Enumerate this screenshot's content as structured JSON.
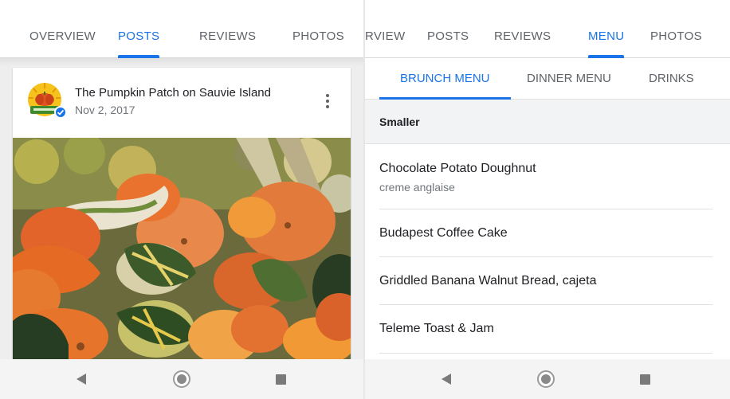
{
  "left_screen": {
    "tabs": [
      {
        "label": "OVERVIEW",
        "active": false
      },
      {
        "label": "POSTS",
        "active": true
      },
      {
        "label": "REVIEWS",
        "active": false
      },
      {
        "label": "PHOTOS",
        "active": false
      }
    ],
    "post": {
      "author": "The Pumpkin Patch on Sauvie Island",
      "date": "Nov 2, 2017",
      "image": "photo of pumpkins, squash and gourds",
      "menu_icon": "more-vert-icon"
    }
  },
  "right_screen": {
    "tabs": [
      {
        "label": "RVIEW",
        "active": false
      },
      {
        "label": "POSTS",
        "active": false
      },
      {
        "label": "REVIEWS",
        "active": false
      },
      {
        "label": "MENU",
        "active": true
      },
      {
        "label": "PHOTOS",
        "active": false
      }
    ],
    "menu_tabs": [
      {
        "label": "BRUNCH MENU",
        "active": true
      },
      {
        "label": "DINNER MENU",
        "active": false
      },
      {
        "label": "DRINKS",
        "active": false
      }
    ],
    "section": "Smaller",
    "items": [
      {
        "name": "Chocolate Potato Doughnut",
        "description": "creme anglaise"
      },
      {
        "name": "Budapest Coffee Cake",
        "description": ""
      },
      {
        "name": "Griddled Banana Walnut Bread, cajeta",
        "description": ""
      },
      {
        "name": "Teleme Toast & Jam",
        "description": ""
      }
    ]
  },
  "nav_bar": {
    "icons": [
      "back-icon",
      "home-icon",
      "recents-icon"
    ]
  },
  "colors": {
    "accent": "#1a73e8",
    "text_primary": "#202124",
    "text_secondary": "#70757a"
  }
}
